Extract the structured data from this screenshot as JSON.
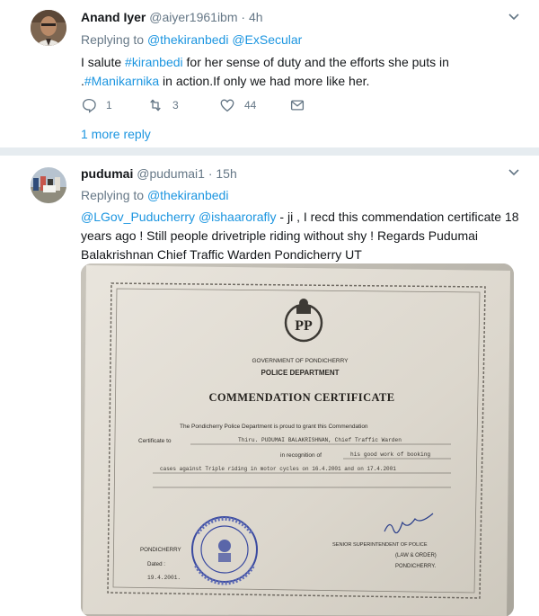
{
  "tweets": [
    {
      "name": "Anand Iyer",
      "handle": "@aiyer1961ibm",
      "time": "· 4h",
      "replying_prefix": "Replying to",
      "replying_to": "@thekiranbedi @ExSecular",
      "text_parts": [
        "I salute ",
        "#kiranbedi",
        " for her sense of duty and the efforts she puts in .",
        "#Manikarnika",
        " in action.If only we had more like her."
      ],
      "reply_count": "1",
      "retweet_count": "3",
      "like_count": "44",
      "more_replies": "1 more reply",
      "caret_icon": "chevron-down-icon"
    },
    {
      "name": "pudumai",
      "handle": "@pudumai1",
      "time": "· 15h",
      "replying_prefix": "Replying to",
      "replying_to": "@thekiranbedi",
      "text_parts": [
        "@LGov_Puducherry @ishaarorafly",
        " - ji , I recd this commendation certificate 18 years ago ! Still people drivetriple riding without shy ! Regards Pudumai Balakrishnan Chief Traffic Warden Pondicherry UT"
      ],
      "caret_icon": "chevron-down-icon"
    }
  ],
  "certificate": {
    "gov": "GOVERNMENT OF PONDICHERRY",
    "dept": "POLICE DEPARTMENT",
    "title": "COMMENDATION CERTIFICATE",
    "line1": "The Pondicherry Police Department is proud to grant this Commendation",
    "line2a": "Certificate to",
    "line2b": "Thiru. PUDUMAI BALAKRISHNAN, Chief Traffic Warden",
    "line3a": "in recognition of",
    "line3b": "his good work of booking",
    "line4": "cases against Triple riding in motor cycles on 16.4.2001 and on 17.4.2001",
    "place": "PONDICHERRY",
    "dated_label": "Dated :",
    "date": "19.4.2001.",
    "sig_left": "SENIOR SUPERINTENDENT OF POLICE",
    "sig_role": "(LAW & ORDER)",
    "sig_place": "PONDICHERRY.",
    "emblem_text": "PP"
  },
  "colors": {
    "link": "#1b95e0",
    "meta": "#657786",
    "text": "#14171a",
    "divider": "#e6ecf0"
  }
}
